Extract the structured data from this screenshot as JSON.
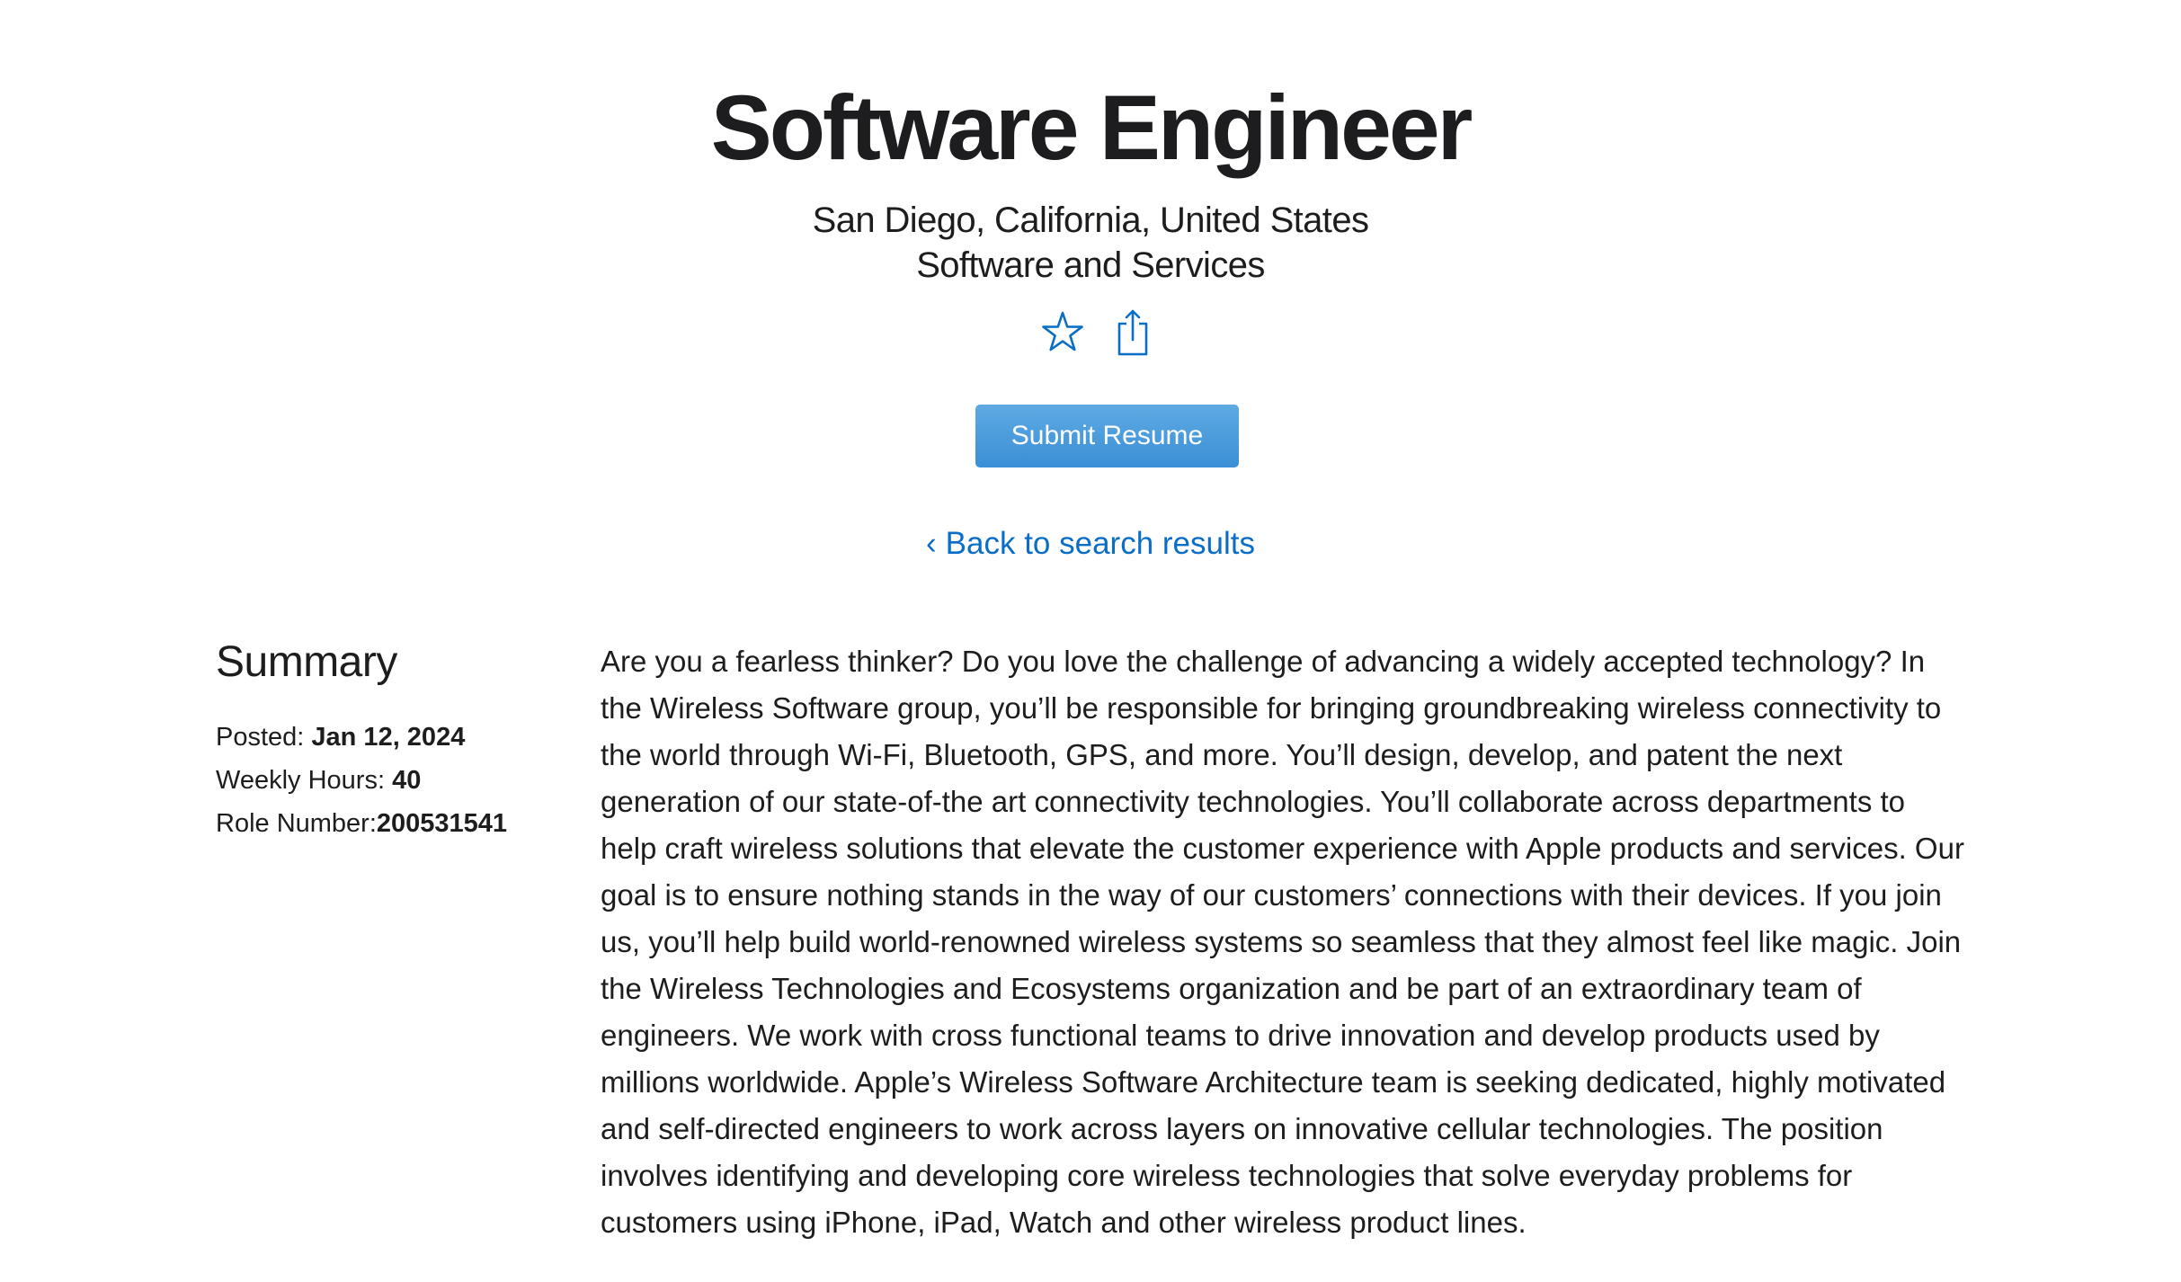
{
  "job": {
    "title": "Software Engineer",
    "location": "San Diego, California, United States",
    "team": "Software and Services"
  },
  "actions": {
    "favorite_icon": "star-icon",
    "share_icon": "share-icon",
    "accent_color": "#3a8fd6",
    "submit_label": "Submit Resume",
    "back_label": "Back to search results",
    "back_chevron": "‹",
    "link_color": "#0a6ec7"
  },
  "summary": {
    "heading": "Summary",
    "posted_label": "Posted: ",
    "posted_value": "Jan 12, 2024",
    "hours_label": "Weekly Hours: ",
    "hours_value": "40",
    "role_label": "Role Number:",
    "role_value": "200531541"
  },
  "description": "Are you a fearless thinker? Do you love the challenge of advancing a widely accepted technology? In the Wireless Software group, you’ll be responsible for bringing groundbreaking wireless connectivity to the world through Wi-Fi, Bluetooth, GPS, and more. You’ll design, develop, and patent the next generation of our state-of-the art connectivity technologies. You’ll collaborate across departments to help craft wireless solutions that elevate the customer experience with Apple products and services. Our goal is to ensure nothing stands in the way of our customers’ connections with their devices. If you join us, you’ll help build world-renowned wireless systems so seamless that they almost feel like magic.   Join the Wireless Technologies and Ecosystems organization and be part of an extraordinary team of engineers. We work with cross functional teams to drive innovation and develop products used by millions worldwide. Apple’s Wireless Software Architecture team is seeking dedicated, highly motivated and self-directed engineers to work across layers on innovative cellular technologies. The position involves identifying and developing core wireless technologies that solve everyday problems for customers using iPhone, iPad, Watch and other wireless product lines."
}
